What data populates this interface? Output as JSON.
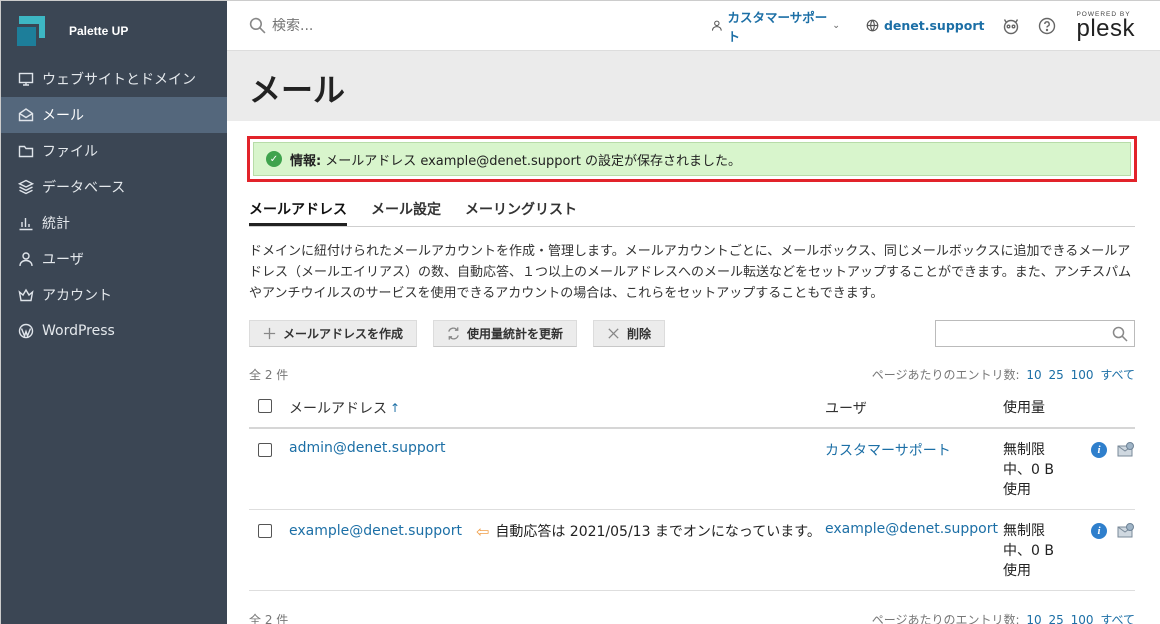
{
  "brand": {
    "name": "Palette UP"
  },
  "sidebar": {
    "items": [
      {
        "label": "ウェブサイトとドメイン",
        "icon": "monitor-icon"
      },
      {
        "label": "メール",
        "icon": "mail-icon",
        "active": true
      },
      {
        "label": "ファイル",
        "icon": "folder-icon"
      },
      {
        "label": "データベース",
        "icon": "database-icon"
      },
      {
        "label": "統計",
        "icon": "bar-chart-icon"
      },
      {
        "label": "ユーザ",
        "icon": "user-icon"
      },
      {
        "label": "アカウント",
        "icon": "crown-icon"
      },
      {
        "label": "WordPress",
        "icon": "wordpress-icon"
      }
    ],
    "collapse_glyph": "‹"
  },
  "topbar": {
    "search_placeholder": "検索...",
    "user_menu": "カスタマーサポート",
    "caret": "⌄",
    "domain": "denet.support",
    "powered_by": "POWERED BY",
    "plesk": "plesk"
  },
  "page": {
    "title": "メール"
  },
  "alert": {
    "label": "情報:",
    "message": "メールアドレス example@denet.support の設定が保存されました。",
    "check": "✓"
  },
  "tabs": [
    {
      "label": "メールアドレス",
      "active": true
    },
    {
      "label": "メール設定"
    },
    {
      "label": "メーリングリスト"
    }
  ],
  "description": "ドメインに紐付けられたメールアカウントを作成・管理します。メールアカウントごとに、メールボックス、同じメールボックスに追加できるメールアドレス（メールエイリアス）の数、自動応答、１つ以上のメールアドレスへのメール転送などをセットアップすることができます。また、アンチスパムやアンチウイルスのサービスを使用できるアカウントの場合は、これらをセットアップすることもできます。",
  "toolbar": {
    "create_label": "メールアドレスを作成",
    "refresh_label": "使用量統計を更新",
    "delete_label": "削除"
  },
  "list_meta": {
    "count": "全 2 件",
    "per_page_label": "ページあたりのエントリ数:",
    "options": [
      "10",
      "25",
      "100",
      "すべて"
    ]
  },
  "table": {
    "headers": {
      "email": "メールアドレス",
      "sort": "↑",
      "user": "ユーザ",
      "usage": "使用量"
    },
    "rows": [
      {
        "email": "admin@denet.support",
        "auto_reply": "",
        "user": "カスタマーサポート",
        "usage": [
          "無制限",
          "中、0 B",
          "使用"
        ]
      },
      {
        "email": "example@denet.support",
        "auto_reply": "自動応答は 2021/05/13 までオンになっています。",
        "auto_reply_icon": "⇦",
        "user": "example@denet.support",
        "usage": [
          "無制限",
          "中、0 B",
          "使用"
        ]
      }
    ],
    "info_glyph": "i"
  }
}
